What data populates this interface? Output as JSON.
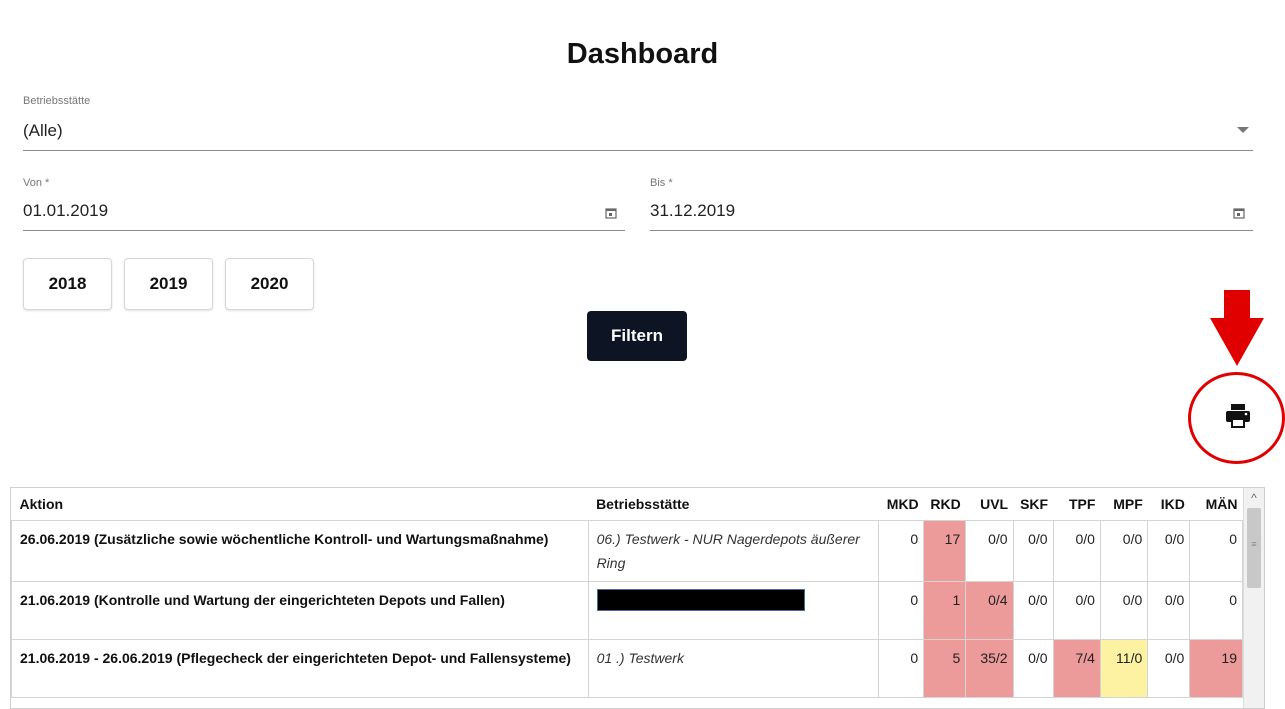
{
  "page": {
    "title": "Dashboard"
  },
  "filters": {
    "betriebsstaette": {
      "label": "Betriebsstätte",
      "value": "(Alle)"
    },
    "von": {
      "label": "Von *",
      "value": "01.01.2019"
    },
    "bis": {
      "label": "Bis *",
      "value": "31.12.2019"
    },
    "years": [
      "2018",
      "2019",
      "2020"
    ],
    "filter_button": "Filtern"
  },
  "annotation": {
    "accent_color": "#e00000",
    "highlight": "print-icon"
  },
  "table": {
    "headers": [
      "Aktion",
      "Betriebsstätte",
      "MKD",
      "RKD",
      "UVL",
      "SKF",
      "TPF",
      "MPF",
      "IKD",
      "MÄN"
    ],
    "rows": [
      {
        "aktion": "26.06.2019 (Zusätzliche sowie wöchentliche Kontroll- und Wartungsmaßnahme)",
        "betriebsstaette": "06.) Testwerk - NUR Nagerdepots äußerer Ring",
        "cells": [
          "0",
          "17",
          "0/0",
          "0/0",
          "0/0",
          "0/0",
          "0/0",
          "0"
        ]
      },
      {
        "aktion": "21.06.2019 (Kontrolle und Wartung der eingerichteten Depots und Fallen)",
        "betriebsstaette": "",
        "cells": [
          "0",
          "1",
          "0/4",
          "0/0",
          "0/0",
          "0/0",
          "0/0",
          "0"
        ]
      },
      {
        "aktion": "21.06.2019 - 26.06.2019 (Pflegecheck der eingerichteten Depot- und Fallensysteme)",
        "betriebsstaette": "01 .) Testwerk",
        "cells": [
          "0",
          "5",
          "35/2",
          "0/0",
          "7/4",
          "11/0",
          "0/0",
          "19"
        ]
      }
    ]
  },
  "colors": {
    "red_cell": "#ec9a9a",
    "yellow_cell": "#fdf2a2",
    "filter_button_bg": "#0d1524"
  }
}
